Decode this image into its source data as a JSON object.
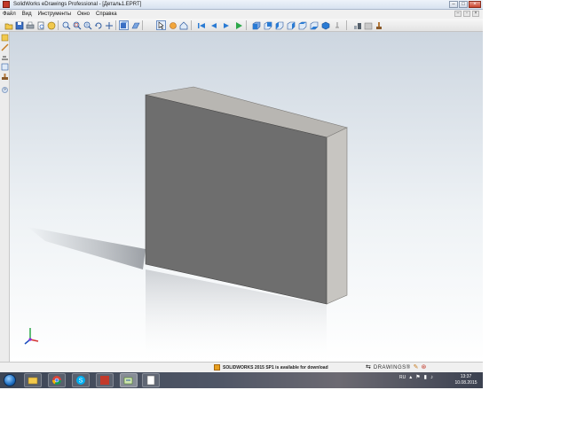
{
  "window": {
    "title": "SolidWorks eDrawings Professional - [Деталь1.EPRT]",
    "controls": [
      "–",
      "□",
      "×"
    ]
  },
  "menu": {
    "items": [
      "Файл",
      "Вид",
      "Инструменты",
      "Окно",
      "Справка"
    ],
    "doc_controls": [
      "–",
      "▫",
      "×"
    ]
  },
  "toolbar": {
    "icons": [
      "open-icon",
      "save-icon",
      "print-icon",
      "print-preview-icon",
      "help-icon",
      "zoom-to-fit-icon",
      "zoom-to-area-icon",
      "zoom-in-out-icon",
      "rotate-icon",
      "pan-icon",
      "shaded-icon",
      "perspective-icon",
      "select-icon",
      "3d-pointer-icon",
      "home-icon",
      "first-frame-icon",
      "previous-frame-icon",
      "next-frame-icon",
      "play-icon",
      "front-view-icon",
      "back-view-icon",
      "left-view-icon",
      "right-view-icon",
      "top-view-icon",
      "bottom-view-icon",
      "isometric-view-icon",
      "measure-icon",
      "section-icon",
      "mark-icon",
      "stamp-icon"
    ]
  },
  "side_pane": {
    "icons": [
      "markup-icon",
      "pencil-icon",
      "measure-icon",
      "component-icon",
      "stamp-icon"
    ],
    "expand_label": "»"
  },
  "viewport": {
    "model_face_color": "#6e6e6e",
    "model_top_color": "#b8b6b2",
    "model_side_color": "#c7c5c1"
  },
  "status": {
    "notice": "SOLIDWORKS 2015 SP1 is available for download",
    "brand": "DRAWINGS®"
  },
  "taskbar": {
    "apps": [
      "explorer",
      "chrome",
      "skype",
      "solidworks",
      "edrawings",
      "notepad"
    ],
    "tray": {
      "language": "RU",
      "time": "13:37",
      "date": "10.08.2015"
    }
  }
}
